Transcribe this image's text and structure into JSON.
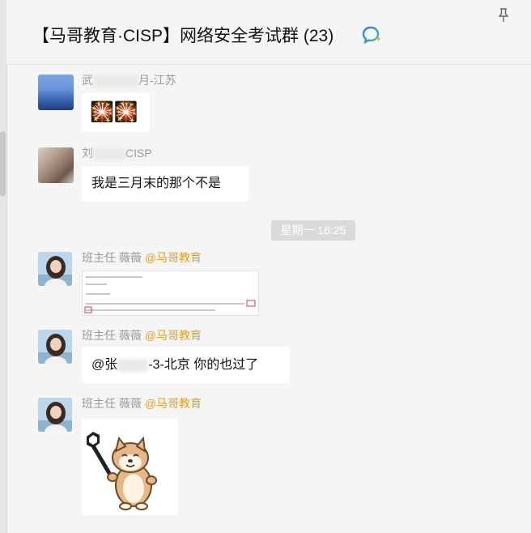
{
  "header": {
    "title": "【马哥教育·CISP】网络安全考试群 (23)",
    "ai_icon": "chat-ai-icon",
    "pin_icon": "pin-icon"
  },
  "timestamp": "星期一 16:25",
  "messages": [
    {
      "sender_prefix": "武",
      "sender_suffix": "月-江苏",
      "content_type": "emoji",
      "content": "🎇🎇"
    },
    {
      "sender_prefix": "刘",
      "sender_suffix": "CISP",
      "content_type": "text",
      "content": "我是三月末的那个不是"
    },
    {
      "sender": "班主任 薇薇",
      "org": "@马哥教育",
      "content_type": "document-image"
    },
    {
      "sender": "班主任 薇薇",
      "org": "@马哥教育",
      "content_type": "text",
      "content_prefix": "@张",
      "content_suffix": "-3-北京 你的也过了"
    },
    {
      "sender": "班主任 薇薇",
      "org": "@马哥教育",
      "content_type": "sticker",
      "sticker_icon": "shiba-dog-sticker"
    }
  ],
  "colors": {
    "org_tag": "#e0a020",
    "bubble": "#ffffff",
    "background": "#f5f5f5"
  }
}
